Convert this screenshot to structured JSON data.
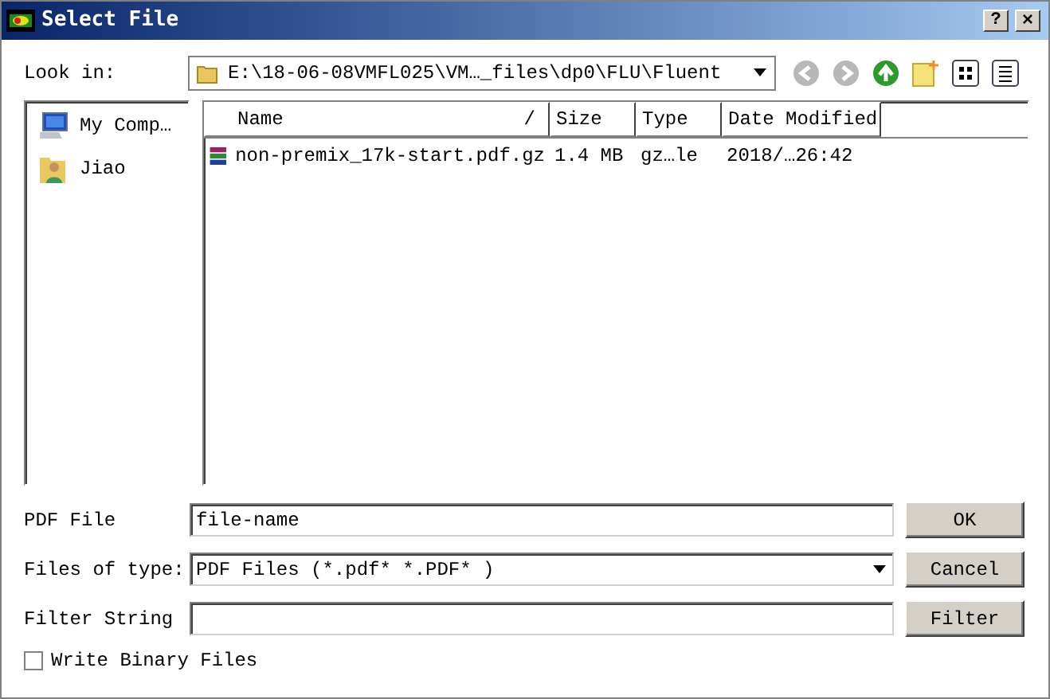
{
  "window": {
    "title": "Select File",
    "controls": [
      "?",
      "×"
    ]
  },
  "look_in": {
    "label": "Look in:",
    "value": "E:\\18-06-08VMFL025\\VM…_files\\dp0\\FLU\\Fluent"
  },
  "places": [
    {
      "kind": "computer",
      "label": "My Comp…"
    },
    {
      "kind": "user",
      "label": "Jiao"
    }
  ],
  "file_list": {
    "columns": [
      "Name",
      "Size",
      "Type",
      "Date Modified"
    ],
    "sort_mark": "/",
    "rows": [
      {
        "kind": "archive",
        "cells": [
          "non-premix_17k-start.pdf.gz",
          "1.4 MB",
          "gz…le",
          "2018/…26:42"
        ]
      }
    ]
  },
  "fields": [
    {
      "kind": "text",
      "label": "PDF File",
      "value": "file-name",
      "button": "OK"
    },
    {
      "kind": "dropdown",
      "label": "Files of type:",
      "value": "PDF Files (*.pdf* *.PDF* )",
      "button": "Cancel"
    },
    {
      "kind": "text",
      "label": "Filter String",
      "button": "Filter"
    }
  ],
  "checkbox": {
    "label": "Write Binary Files",
    "checked": false
  }
}
